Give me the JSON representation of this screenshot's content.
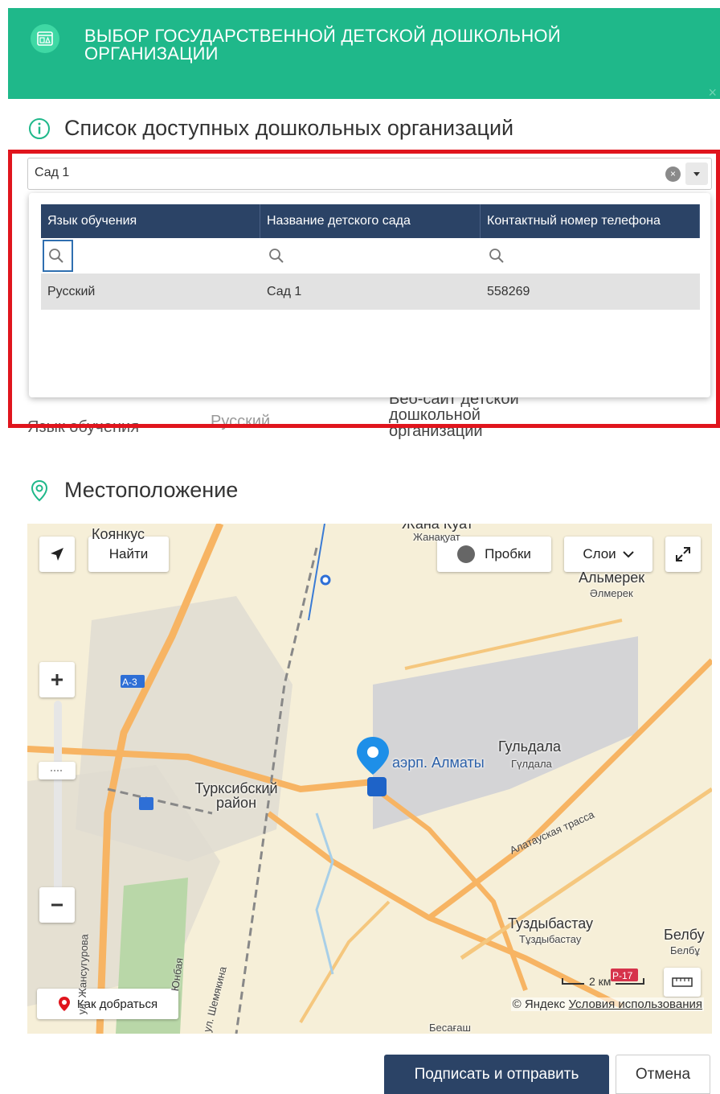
{
  "header": {
    "title": "ВЫБОР ГОСУДАРСТВЕННОЙ ДЕТСКОЙ ДОШКОЛЬНОЙ ОРГАНИЗАЦИИ",
    "close_label": "×",
    "color": "#1fb88a"
  },
  "section_list": {
    "title": "Список доступных дошкольных организаций",
    "icon": "info-icon"
  },
  "combo": {
    "value": "Сад 1",
    "clear_label": "×"
  },
  "grid": {
    "columns": [
      "Язык обучения",
      "Название детского сада",
      "Контактный номер телефона"
    ],
    "rows": [
      [
        "Русский",
        "Сад 1",
        "558269"
      ]
    ]
  },
  "hidden_row": {
    "label": "Язык обучения",
    "value": "Русский",
    "website_label": "Веб-сайт детской дошкольной организации"
  },
  "section_location": {
    "title": "Местоположение",
    "icon": "map-pin-icon"
  },
  "map": {
    "find_label": "Найти",
    "traffic_label": "Пробки",
    "layers_label": "Слои",
    "route_label": "Как добраться",
    "scale_label": "2 км",
    "copyright": "© Яндекс",
    "terms_label": "Условия использования",
    "labels": {
      "koyankus": "Коянкус",
      "zhana_kuat": "Жана Куат",
      "zhanakuat": "Жанақуат",
      "almerek": "Альмерек",
      "almerek_kz": "Әлмерек",
      "airport": "аэрп. Алматы",
      "guldala": "Гульдала",
      "guldala_kz": "Гүлдала",
      "turksib": "Турксибский район",
      "alatau": "Алатауская трасса",
      "tuzdybastau": "Туздыбастау",
      "tuzdybastau_kz": "Тұздыбастау",
      "belbulak": "Белбу",
      "belbulak_kz": "Белбұ",
      "besagash": "Бесағаш",
      "zhansugurov": "ул. Жансугурова",
      "shemyakina": "ул. Шемякина",
      "yunbaya": "Юнбая",
      "road_a3": "A-3",
      "road_r17": "P-17"
    }
  },
  "footer": {
    "submit_label": "Подписать и отправить",
    "cancel_label": "Отмена",
    "primary_color": "#2b4366"
  }
}
